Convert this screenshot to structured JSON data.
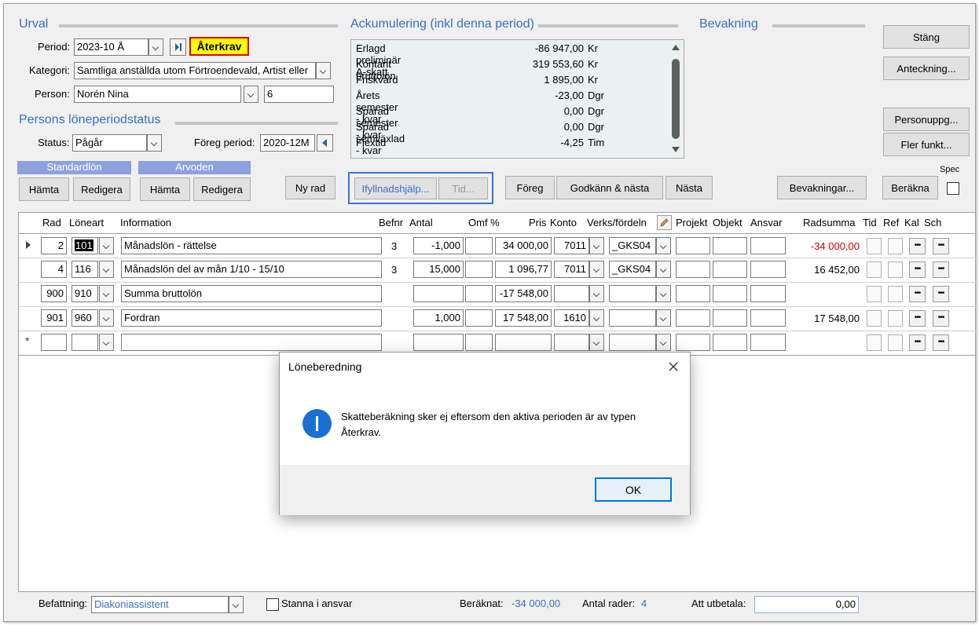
{
  "urval": {
    "title": "Urval",
    "period_label": "Period:",
    "period_value": "2023-10 Å",
    "aterkrav_badge": "Återkrav",
    "kategori_label": "Kategori:",
    "kategori_value": "Samtliga anställda utom Förtroendevald, Artist eller",
    "person_label": "Person:",
    "person_value": "Norén Nina",
    "person_number": "6"
  },
  "status_section": {
    "title": "Persons löneperiodstatus",
    "status_label": "Status:",
    "status_value": "Pågår",
    "foreg_label": "Föreg period:",
    "foreg_value": "2020-12M"
  },
  "accumulation": {
    "title": "Ackumulering (inkl denna period)",
    "rows": [
      {
        "label": "Erlagd preliminär A-skatt",
        "value": "-86 947,00",
        "unit": "Kr"
      },
      {
        "label": "Kontant bruttolön",
        "value": "319 553,60",
        "unit": "Kr"
      },
      {
        "label": "Friskvård",
        "value": "1 895,00",
        "unit": "Kr"
      },
      {
        "label": "Årets semester - kvar",
        "value": "-23,00",
        "unit": "Dgr"
      },
      {
        "label": "Sparad semester - kvar",
        "value": "0,00",
        "unit": "Dgr"
      },
      {
        "label": "Sparad semväxlad - kvar",
        "value": "0,00",
        "unit": "Dgr"
      },
      {
        "label": "Flextid",
        "value": "-4,25",
        "unit": "Tim"
      }
    ]
  },
  "bevakning": {
    "title": "Bevakning"
  },
  "right_buttons": {
    "stang": "Stäng",
    "anteckning": "Anteckning...",
    "personuppg": "Personuppg...",
    "fler_funkt": "Fler funkt..."
  },
  "toolbar": {
    "standardlon_title": "Standardlön",
    "arvoden_title": "Arvoden",
    "hamta1": "Hämta",
    "redigera1": "Redigera",
    "hamta2": "Hämta",
    "redigera2": "Redigera",
    "ny_rad": "Ny rad",
    "ifyllnadshjalp": "Ifyllnadshjälp...",
    "tid": "Tid...",
    "foreg": "Föreg",
    "godkann_nasta": "Godkänn & nästa",
    "nasta": "Nästa",
    "bevakningar": "Bevakningar...",
    "berakna": "Beräkna",
    "spec": "Spec"
  },
  "grid": {
    "headers": {
      "rad": "Rad",
      "loneart": "Löneart",
      "information": "Information",
      "befnr": "Befnr",
      "antal": "Antal",
      "omf": "Omf %",
      "pris": "Pris",
      "konto": "Konto",
      "verks": "Verks/fördeln",
      "projekt": "Projekt",
      "objekt": "Objekt",
      "ansvar": "Ansvar",
      "radsumma": "Radsumma",
      "tid": "Tid",
      "ref": "Ref",
      "kal": "Kal",
      "sch": "Sch"
    },
    "rows": [
      {
        "rad": "2",
        "loneart": "101",
        "info": "Månadslön  - rättelse",
        "befnr": "3",
        "antal": "-1,000",
        "omf": "",
        "pris": "34 000,00",
        "konto": "7011",
        "verks": "_GKS04",
        "radsumma": "-34 000,00"
      },
      {
        "rad": "4",
        "loneart": "116",
        "info": "Månadslön del av mån 1/10 - 15/10",
        "befnr": "3",
        "antal": "15,000",
        "omf": "",
        "pris": "1 096,77",
        "konto": "7011",
        "verks": "_GKS04",
        "radsumma": "16 452,00"
      },
      {
        "rad": "900",
        "loneart": "910",
        "info": "Summa bruttolön",
        "befnr": "",
        "antal": "",
        "omf": "",
        "pris": "-17 548,00",
        "konto": "",
        "verks": "",
        "radsumma": ""
      },
      {
        "rad": "901",
        "loneart": "960",
        "info": "Fordran",
        "befnr": "",
        "antal": "1,000",
        "omf": "",
        "pris": "17 548,00",
        "konto": "1610",
        "verks": "",
        "radsumma": "17 548,00"
      },
      {
        "rad": "",
        "loneart": "",
        "info": "",
        "befnr": "",
        "antal": "",
        "omf": "",
        "pris": "",
        "konto": "",
        "verks": "",
        "radsumma": ""
      }
    ],
    "new_row_marker": "*"
  },
  "footer": {
    "befattning_label": "Befattning:",
    "befattning_value": "Diakoniassistent",
    "stanna_label": "Stanna i ansvar",
    "beraknat_label": "Beräknat:",
    "beraknat_value": "-34 000,00",
    "antal_rader_label": "Antal rader:",
    "antal_rader_value": "4",
    "att_utbetala_label": "Att utbetala:",
    "att_utbetala_value": "0,00"
  },
  "dialog": {
    "title": "Löneberedning",
    "message": "Skatteberäkning sker ej eftersom den aktiva perioden är av typen Återkrav.",
    "ok": "OK"
  },
  "colors": {
    "accent_blue": "#3b6fc4",
    "negative_red": "#d00000",
    "badge_yellow": "#ffff00",
    "badge_border": "#e00000",
    "band": "#8da2dc"
  }
}
